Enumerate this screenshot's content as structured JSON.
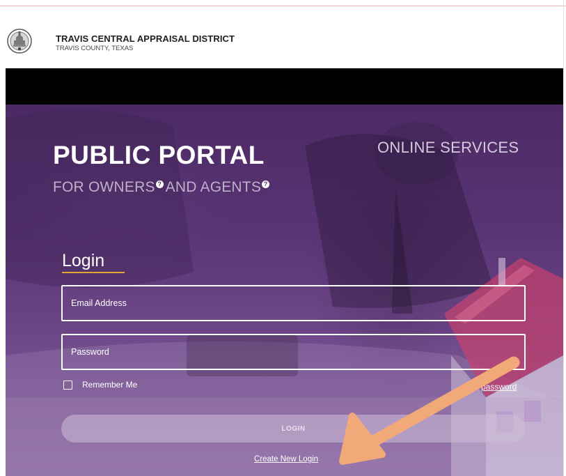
{
  "header": {
    "org_name": "TRAVIS CENTRAL APPRAISAL DISTRICT",
    "org_sub": "TRAVIS COUNTY, TEXAS",
    "logo_icon": "county-seal-icon"
  },
  "hero": {
    "title": "PUBLIC PORTAL",
    "online_services": "ONLINE SERVICES",
    "subtitle_part1": "FOR OWNERS",
    "subtitle_part2": "AND AGENTS",
    "help_glyph": "?"
  },
  "login": {
    "heading": "Login",
    "email_placeholder": "Email Address",
    "password_placeholder": "Password",
    "remember_label": "Remember Me",
    "forgot_label": "password",
    "login_button": "LOGIN",
    "create_link": "Create New Login"
  },
  "colors": {
    "accent_underline": "#e0a830",
    "arrow": "#f2a97a",
    "hero_purple": "#5a3474"
  },
  "annotation": {
    "arrow_icon": "arrow-icon"
  }
}
